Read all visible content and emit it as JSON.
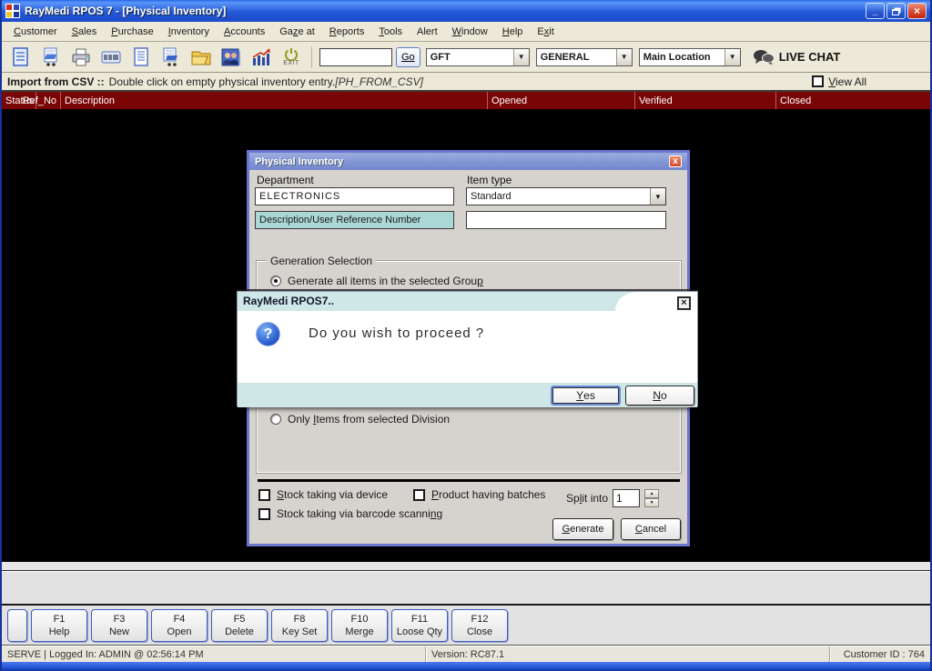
{
  "window": {
    "title": "RayMedi RPOS 7 - [Physical Inventory]"
  },
  "menu": {
    "items": [
      {
        "text": "Customer",
        "u": 0
      },
      {
        "text": "Sales",
        "u": 0
      },
      {
        "text": "Purchase",
        "u": 0
      },
      {
        "text": "Inventory",
        "u": 0
      },
      {
        "text": "Accounts",
        "u": 0
      },
      {
        "text": "Gaze at",
        "u": 2
      },
      {
        "text": "Reports",
        "u": 0
      },
      {
        "text": "Tools",
        "u": 0
      },
      {
        "text": "Alert",
        "u": -1
      },
      {
        "text": "Window",
        "u": 0
      },
      {
        "text": "Help",
        "u": 0
      },
      {
        "text": "Exit",
        "u": 1
      }
    ]
  },
  "toolbar": {
    "icons": [
      "invoice-icon",
      "sales-cart-icon",
      "printer-icon",
      "barcode-icon",
      "document-icon",
      "purchase-cart-icon",
      "folder-icon",
      "users-icon",
      "chart-icon",
      "exit-icon"
    ],
    "exit_label": "EXIT",
    "search_value": "",
    "go": {
      "text": "Go",
      "u": -1
    },
    "combos": [
      {
        "value": "GFT"
      },
      {
        "value": "GENERAL"
      },
      {
        "value": "Main Location"
      }
    ],
    "live_chat": "LIVE CHAT"
  },
  "info_bar": {
    "bold": "Import from CSV ::",
    "text": "Double click on empty physical inventory entry.",
    "code": "[PH_FROM_CSV]",
    "view_all": {
      "text": "View All",
      "u": 0
    }
  },
  "grid": {
    "columns": [
      "Status",
      "Ref_No",
      "Description",
      "Opened",
      "Verified",
      "Closed"
    ]
  },
  "dialog": {
    "title": "Physical Inventory",
    "close_glyph": "x",
    "department": {
      "label": "Department",
      "value": "ELECTRONICS"
    },
    "item_type": {
      "label": "Item type",
      "value": "Standard"
    },
    "desc_button": "Description/User Reference Number",
    "desc_value": "",
    "group": {
      "title": "Generation Selection",
      "radio_all": {
        "text": "Generate all items in the selected Group",
        "u": 39,
        "selected": true
      },
      "radio_division": {
        "text": "Only Items from selected Division",
        "u": 5,
        "selected": false
      }
    },
    "checkboxes": [
      {
        "text": "Stock taking via device",
        "u": 0,
        "checked": false
      },
      {
        "text": "Product having batches",
        "u": 0,
        "checked": false
      },
      {
        "text": "Stock taking via barcode scanning",
        "u": 31,
        "checked": false
      }
    ],
    "split": {
      "label": {
        "text": "Split into",
        "u": 2
      },
      "value": "1"
    },
    "generate": {
      "text": "Generate",
      "u": 0
    },
    "cancel": {
      "text": "Cancel",
      "u": 0
    }
  },
  "modal": {
    "title": "RayMedi RPOS7..",
    "close_glyph": "×",
    "message": "Do you wish to proceed ?",
    "question_glyph": "?",
    "yes": {
      "text": "Yes",
      "u": 0
    },
    "no": {
      "text": "No",
      "u": 0
    }
  },
  "function_keys": [
    {
      "key": "F1",
      "label": "Help"
    },
    {
      "key": "F3",
      "label": "New"
    },
    {
      "key": "F4",
      "label": "Open"
    },
    {
      "key": "F5",
      "label": "Delete"
    },
    {
      "key": "F8",
      "label": "Key Set"
    },
    {
      "key": "F10",
      "label": "Merge"
    },
    {
      "key": "F11",
      "label": "Loose Qty"
    },
    {
      "key": "F12",
      "label": "Close"
    }
  ],
  "status_bar": {
    "left": "SERVE | Logged In: ADMIN  @ 02:56:14 PM",
    "center": "Version: RC87.1",
    "right": "Customer ID : 764"
  },
  "colors": {
    "titlebar_blue": "#2458d8",
    "header_maroon": "#7a0505",
    "modal_teal": "#cfe8e7",
    "desc_teal": "#abd7d7",
    "dialog_border": "#6a76d0"
  }
}
